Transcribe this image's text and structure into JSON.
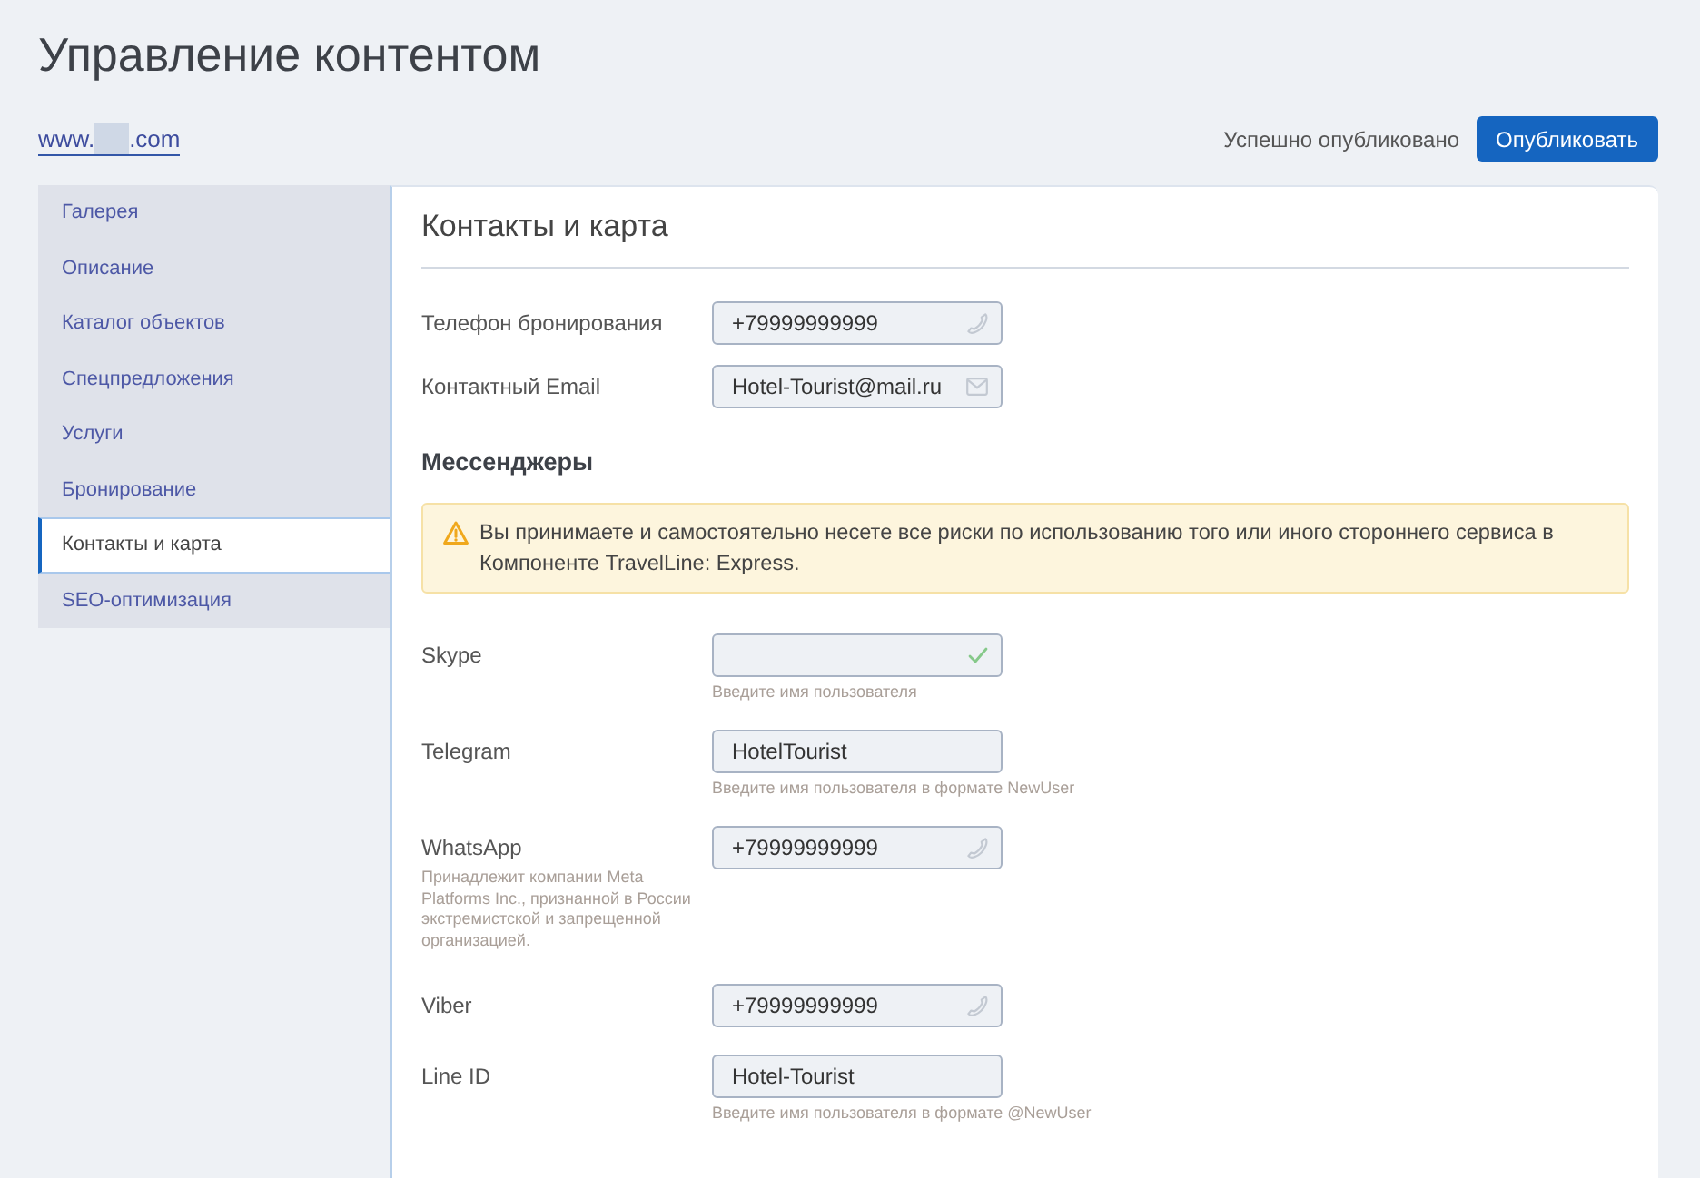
{
  "page": {
    "title": "Управление контентом"
  },
  "site_link": {
    "parts": [
      "www.",
      ".com"
    ],
    "redacted": true
  },
  "publish": {
    "status": "Успешно опубликовано",
    "button": "Опубликовать"
  },
  "sidebar": {
    "items": [
      {
        "label": "Галерея",
        "selected": false
      },
      {
        "label": "Описание",
        "selected": false
      },
      {
        "label": "Каталог объектов",
        "selected": false
      },
      {
        "label": "Спецпредложения",
        "selected": false
      },
      {
        "label": "Услуги",
        "selected": false
      },
      {
        "label": "Бронирование",
        "selected": false
      },
      {
        "label": "Контакты и карта",
        "selected": true
      },
      {
        "label": "SEO-оптимизация",
        "selected": false
      }
    ]
  },
  "section": {
    "title": "Контакты и карта",
    "fields": [
      {
        "kind": "phone",
        "label": "Телефон бронирования",
        "value": "+79999999999"
      },
      {
        "kind": "email",
        "label": "Контактный Email",
        "value": "Hotel-Tourist@mail.ru"
      }
    ]
  },
  "messengers": {
    "title": "Мессенджеры",
    "warning": "Вы принимаете и самостоятельно несете все риски по использованию того или иного стороннего сервиса в Компоненте TravelLine: Express.",
    "fields": [
      {
        "kind": "text",
        "label": "Skype",
        "valid": true,
        "hint": "Введите имя пользователя"
      },
      {
        "kind": "text",
        "label": "Telegram",
        "value": "HotelTourist",
        "valid": false,
        "hint": "Введите имя пользователя в формате NewUser"
      },
      {
        "kind": "phone",
        "label": "WhatsApp",
        "value": "+79999999999",
        "valid": false,
        "note": "Принадлежит компании Meta Platforms Inc., признанной в России экстремистской и запрещенной организацией."
      },
      {
        "kind": "phone",
        "label": "Viber",
        "value": "+79999999999",
        "valid": false
      },
      {
        "kind": "text",
        "label": "Line ID",
        "value": "Hotel-Tourist",
        "valid": false,
        "hint": "Введите имя пользователя в формате @NewUser"
      }
    ]
  }
}
